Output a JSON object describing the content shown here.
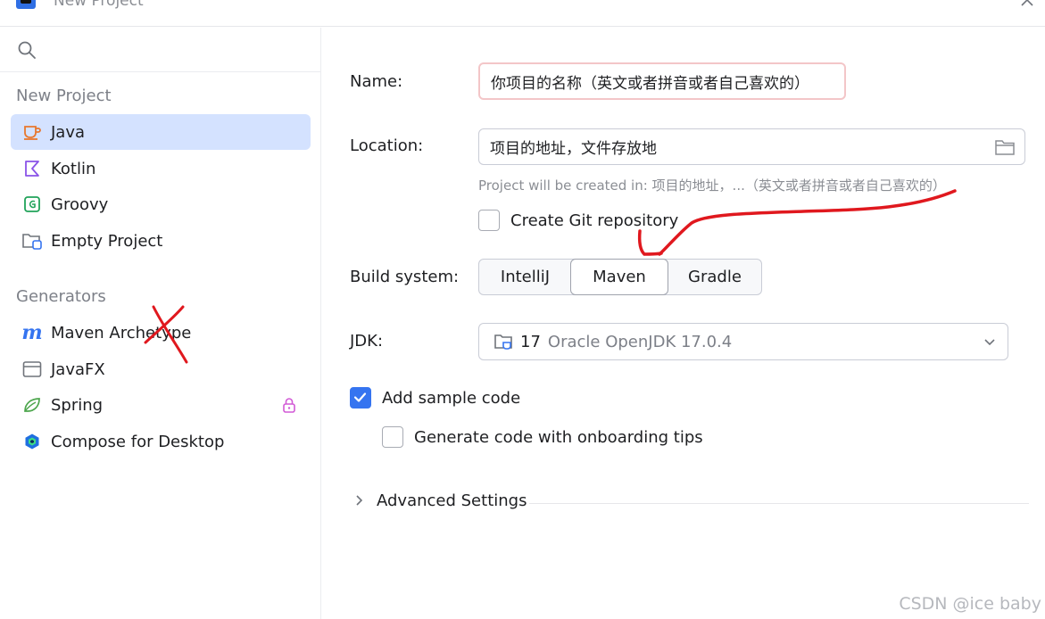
{
  "window": {
    "title": "New Project"
  },
  "sidebar": {
    "search_placeholder": "",
    "sections": {
      "new_project": "New Project",
      "generators": "Generators"
    },
    "items": [
      {
        "label": "Java",
        "icon": "java-icon",
        "selected": true
      },
      {
        "label": "Kotlin",
        "icon": "kotlin-icon"
      },
      {
        "label": "Groovy",
        "icon": "groovy-icon"
      },
      {
        "label": "Empty Project",
        "icon": "empty-project-icon"
      }
    ],
    "generators": [
      {
        "label": "Maven Archetype",
        "icon": "maven-icon"
      },
      {
        "label": "JavaFX",
        "icon": "javafx-icon"
      },
      {
        "label": "Spring",
        "icon": "spring-icon",
        "locked": true
      },
      {
        "label": "Compose for Desktop",
        "icon": "compose-icon"
      }
    ]
  },
  "form": {
    "name_label": "Name:",
    "name_value": "你项目的名称（英文或者拼音或者自己喜欢的）",
    "location_label": "Location:",
    "location_value": "项目的地址，文件存放地",
    "location_hint": "Project will be created in: 项目的地址，...（英文或者拼音或者自己喜欢的）",
    "git_label": "Create Git repository",
    "git_checked": false,
    "build_label": "Build system:",
    "build_options": [
      "IntelliJ",
      "Maven",
      "Gradle"
    ],
    "build_selected": "Maven",
    "jdk_label": "JDK:",
    "jdk_version": "17",
    "jdk_name": "Oracle OpenJDK 17.0.4",
    "sample_code_label": "Add sample code",
    "sample_code_checked": true,
    "onboarding_label": "Generate code with onboarding tips",
    "onboarding_checked": false,
    "advanced_label": "Advanced Settings"
  },
  "watermark": "CSDN @ice baby",
  "colors": {
    "accent": "#3574f0",
    "selection": "#d4e2ff",
    "annotation": "#e0181e"
  }
}
